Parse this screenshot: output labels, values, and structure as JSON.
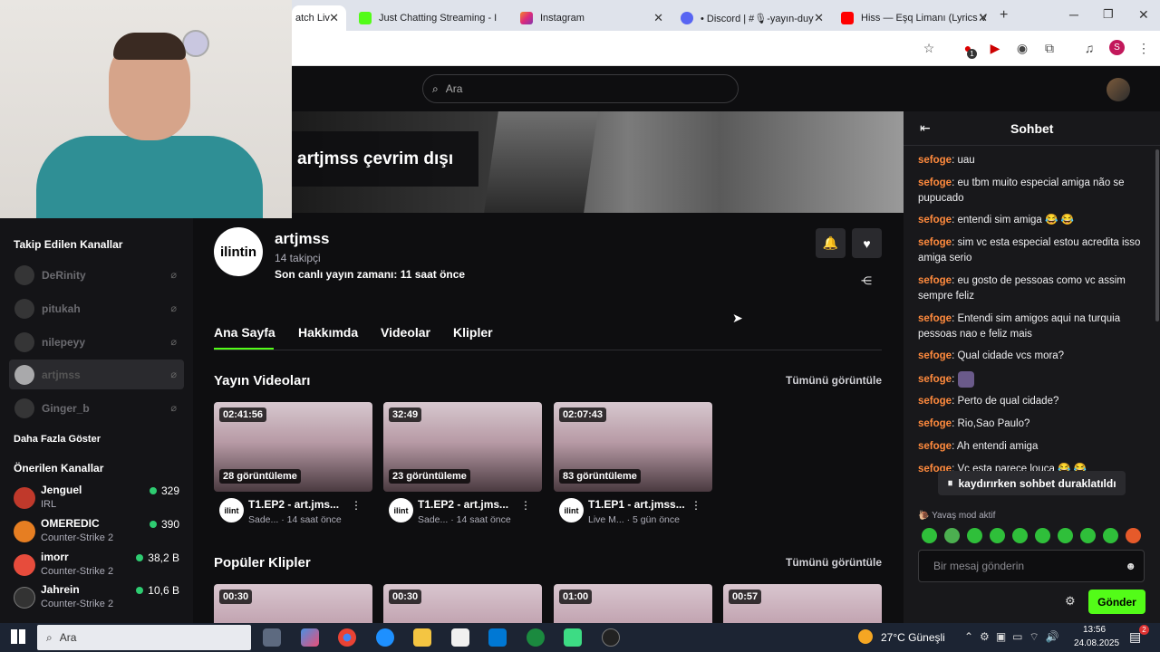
{
  "browser": {
    "tabs": [
      {
        "label": "atch Liv",
        "icon": "kick-icon",
        "active": true
      },
      {
        "label": "Just Chatting Streaming - I",
        "icon": "kick-icon"
      },
      {
        "label": "Instagram",
        "icon": "instagram-icon"
      },
      {
        "label": "• Discord | #🎙-yayın-duy",
        "icon": "discord-icon"
      },
      {
        "label": "Hiss — Eşq Limanı (Lyrics V",
        "icon": "youtube-icon"
      }
    ],
    "new_tab": "+",
    "profile_initial": "S",
    "badge_count": "1"
  },
  "search": {
    "placeholder": "Ara"
  },
  "banner": {
    "offline_text": "artjmss çevrim dışı"
  },
  "channel": {
    "name": "artjmss",
    "followers": "14 takipçi",
    "last_live": "Son canlı yayın zamanı: 11 saat önce",
    "logo_text": "ilintin"
  },
  "tabs": [
    "Ana Sayfa",
    "Hakkımda",
    "Videolar",
    "Klipler"
  ],
  "sections": {
    "videos_title": "Yayın Videoları",
    "clips_title": "Popüler Klipler",
    "see_all": "Tümünü görüntüle"
  },
  "videos": [
    {
      "duration": "02:41:56",
      "views": "28 görüntüleme",
      "title": "T1.EP2 - art.jms...",
      "meta": "Sade... · 14 saat önce"
    },
    {
      "duration": "32:49",
      "views": "23 görüntüleme",
      "title": "T1.EP2 - art.jms...",
      "meta": "Sade... · 14 saat önce"
    },
    {
      "duration": "02:07:43",
      "views": "83 görüntüleme",
      "title": "T1.EP1 - art.jmss...",
      "meta": "Live M... · 5 gün önce"
    }
  ],
  "clips": [
    {
      "duration": "00:30"
    },
    {
      "duration": "00:30"
    },
    {
      "duration": "01:00"
    },
    {
      "duration": "00:57"
    }
  ],
  "sidebar": {
    "followed_title": "Takip Edilen Kanallar",
    "followed": [
      {
        "name": "DeRinity"
      },
      {
        "name": "pitukah"
      },
      {
        "name": "nilepeyy"
      },
      {
        "name": "artjmss"
      },
      {
        "name": "Ginger_b"
      }
    ],
    "show_more": "Daha Fazla Göster",
    "recommended_title": "Önerilen Kanallar",
    "recommended": [
      {
        "name": "Jenguel",
        "game": "IRL",
        "viewers": "329",
        "color": "#c0392b"
      },
      {
        "name": "OMEREDIC",
        "game": "Counter-Strike 2",
        "viewers": "390",
        "color": "#e67e22"
      },
      {
        "name": "imorr",
        "game": "Counter-Strike 2",
        "viewers": "38,2 B",
        "color": "#e74c3c"
      },
      {
        "name": "Jahrein",
        "game": "Counter-Strike 2",
        "viewers": "10,6 B",
        "color": "#222222"
      }
    ]
  },
  "chat": {
    "title": "Sohbet",
    "messages": [
      {
        "user": "sefoge",
        "text": ": uau"
      },
      {
        "user": "sefoge",
        "text": ": eu tbm muito especial amiga não se pupucado"
      },
      {
        "user": "sefoge",
        "text": ": entendi sim amiga 😂 😂"
      },
      {
        "user": "sefoge",
        "text": ": sim vc esta especial estou acredita isso amiga serio"
      },
      {
        "user": "sefoge",
        "text": ": eu gosto de pessoas como vc assim sempre feliz"
      },
      {
        "user": "sefoge",
        "text": ": Entendi sim amigos aqui na turquia pessoas nao e feliz mais"
      },
      {
        "user": "sefoge",
        "text": ": Qual cidade vcs mora?"
      },
      {
        "user": "sefoge",
        "text": ":"
      },
      {
        "user": "sefoge",
        "text": ": Perto de qual cidade?"
      },
      {
        "user": "sefoge",
        "text": ": Rio,Sao Paulo?"
      },
      {
        "user": "sefoge",
        "text": ": Ah entendi amiga"
      },
      {
        "user": "sefoge",
        "text": ": Vc esta parece louca 😂 😂"
      }
    ],
    "paused": "kaydırırken sohbet duraklatıldı",
    "slow_mode": "Yavaş mod aktif",
    "input_placeholder": "Bir mesaj gönderin",
    "send": "Gönder"
  },
  "taskbar": {
    "search": "Ara",
    "weather": "27°C Güneşli",
    "time": "13:56",
    "date": "24.08.2025",
    "notifications": "2"
  }
}
